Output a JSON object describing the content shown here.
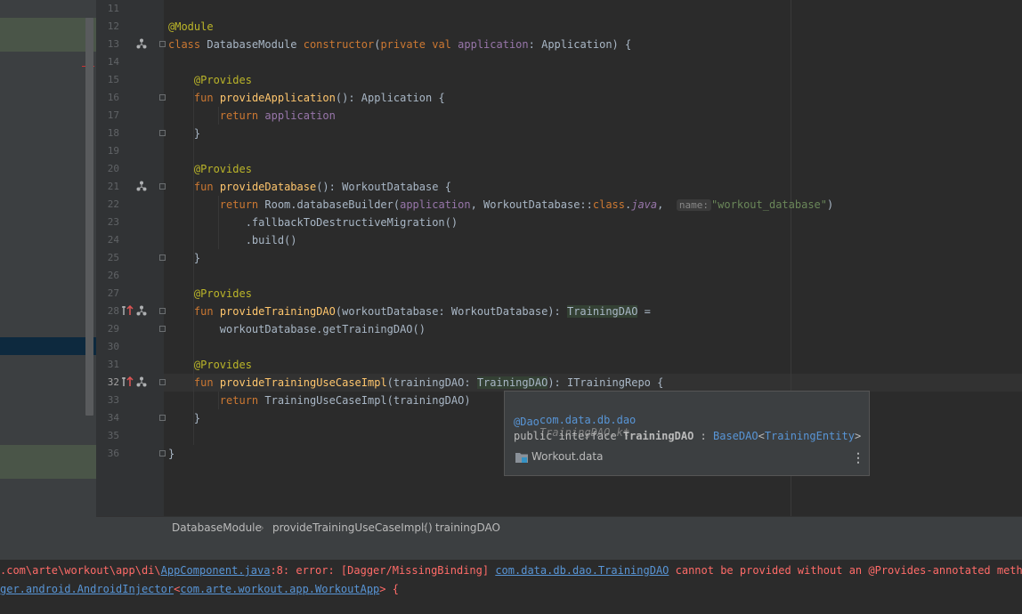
{
  "editor": {
    "line_numbers": [
      "11",
      "12",
      "13",
      "14",
      "15",
      "16",
      "17",
      "18",
      "19",
      "20",
      "21",
      "22",
      "23",
      "24",
      "25",
      "26",
      "27",
      "28",
      "29",
      "30",
      "31",
      "32",
      "33",
      "34",
      "35",
      "36"
    ],
    "current_line": "32",
    "param_hint_name": "name:"
  },
  "popup": {
    "package": "com.data.db.dao",
    "file": "TrainingDAO.kt",
    "annotation": "@Dao",
    "decl_prefix": "public interface ",
    "decl_name": "TrainingDAO",
    "decl_colon": " : ",
    "decl_super": "BaseDAO",
    "decl_lt": "<",
    "decl_generic": "TrainingEntity",
    "decl_gt": ">",
    "module": "Workout.data",
    "more_icon": "more-vertical-icon"
  },
  "breadcrumb": {
    "items": [
      "DatabaseModule",
      "provideTrainingUseCaseImpl()",
      "trainingDAO"
    ],
    "separator_icon": "chevron-right-icon"
  },
  "console": {
    "line1_prefix": ".com\\arte\\workout\\app\\di\\",
    "line1_link": "AppComponent.java",
    "line1_mid": ":8: error: [Dagger/MissingBinding] ",
    "line1_link2": "com.data.db.dao.TrainingDAO",
    "line1_suffix": " cannot be provided without an @Provides-annotated method.",
    "line2_link": "ger.android.AndroidInjector",
    "line2_lt": "<",
    "line2_link2": "com.arte.workout.app.WorkoutApp",
    "line2_suffix": "> {"
  },
  "colors": {
    "error": "#ff6b68",
    "link": "#5895d6",
    "keyword": "#cc7832",
    "annotation": "#bbb529",
    "function": "#ffc66d",
    "property": "#9876aa",
    "string": "#6a8759"
  }
}
